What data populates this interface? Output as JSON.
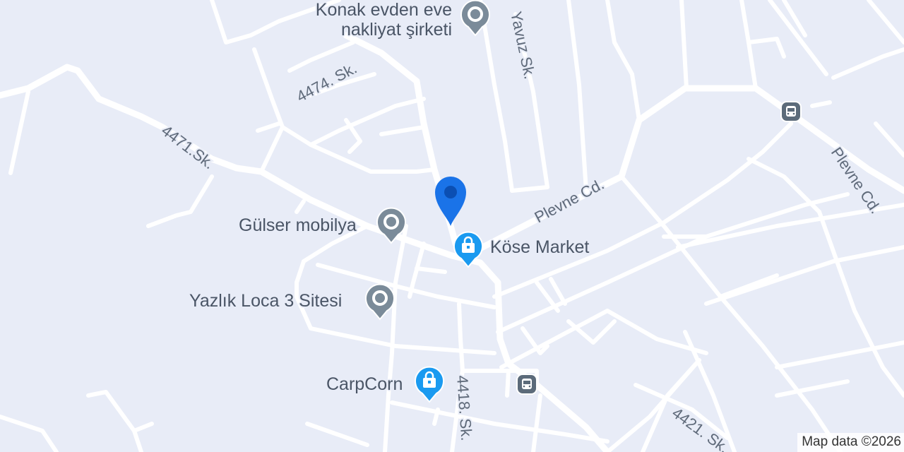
{
  "map": {
    "background": "#e8ecf7",
    "road_color": "#ffffff",
    "street_labels": {
      "yavuz": "Yavuz Sk.",
      "s4474": "4474. Sk.",
      "s4471": "4471.Sk.",
      "plevne1": "Plevne Cd.",
      "plevne2": "Plevne Cd.",
      "s4418": "4418. Sk.",
      "s4421": "4421. Sk."
    },
    "pois": {
      "konak": {
        "line1": "Konak evden eve",
        "line2": "nakliyat şirketi",
        "icon": "place-marker-icon",
        "color": "#7b8b99"
      },
      "gulser": {
        "label": "Gülser mobilya",
        "icon": "place-marker-icon",
        "color": "#7b8b99"
      },
      "yazlik": {
        "label": "Yazlık Loca 3 Sitesi",
        "icon": "place-marker-icon",
        "color": "#7b8b99"
      },
      "kose": {
        "label": "Köse Market",
        "icon": "shopping-bag-icon",
        "color": "#1a9af0"
      },
      "carpcorn": {
        "label": "CarpCorn",
        "icon": "shopping-bag-icon",
        "color": "#1a9af0"
      }
    },
    "location_pin": {
      "icon": "location-pin-icon",
      "color": "#1a73e8"
    },
    "bus_stops": {
      "icon": "bus-stop-icon",
      "color": "#5c6b7a"
    },
    "attribution": "Map data ©2026"
  }
}
